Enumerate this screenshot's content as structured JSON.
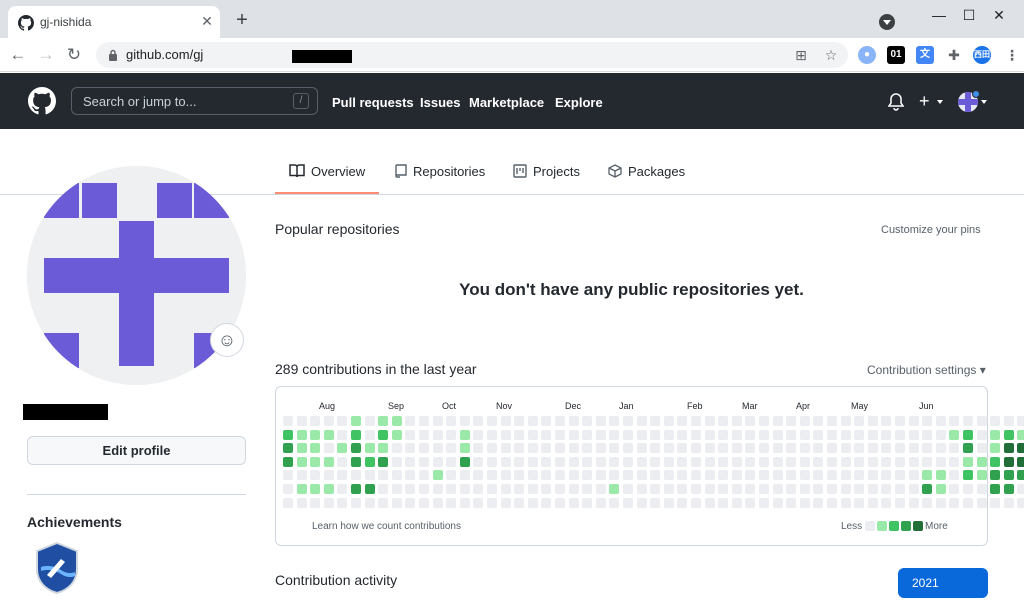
{
  "browser": {
    "tab_title": "gj-nishida",
    "tab_close": "✕",
    "new_tab": "+",
    "url": "github.com/gj",
    "window_controls": [
      "—",
      "☐",
      "✕"
    ],
    "extensions": [
      "01",
      "西田"
    ]
  },
  "header": {
    "search_placeholder": "Search or jump to...",
    "search_shortcut": "/",
    "nav": [
      "Pull requests",
      "Issues",
      "Marketplace",
      "Explore"
    ],
    "plus": "+"
  },
  "tabs": [
    {
      "label": "Overview",
      "icon": "book-icon",
      "active": true
    },
    {
      "label": "Repositories",
      "icon": "repo-icon",
      "active": false
    },
    {
      "label": "Projects",
      "icon": "project-icon",
      "active": false
    },
    {
      "label": "Packages",
      "icon": "package-icon",
      "active": false
    }
  ],
  "sidebar": {
    "emoji": "☺",
    "edit_profile": "Edit profile",
    "achievements_title": "Achievements"
  },
  "main": {
    "popular_title": "Popular repositories",
    "customize_pins": "Customize your pins",
    "no_repos": "You don't have any public repositories yet.",
    "contrib_title": "289 contributions in the last year",
    "contrib_settings": "Contribution settings ▾",
    "learn_link": "Learn how we count contributions",
    "legend_less": "Less",
    "legend_more": "More",
    "activity_title": "Contribution activity",
    "year_button": "2021"
  },
  "calendar": {
    "months": [
      "Aug",
      "Sep",
      "Oct",
      "Nov",
      "Dec",
      "Jan",
      "Feb",
      "Mar",
      "Apr",
      "May",
      "Jun"
    ],
    "colors": [
      "#ebedf0",
      "#9be9a8",
      "#40c463",
      "#30a14e",
      "#216e39"
    ],
    "weeks": [
      [
        0,
        2,
        3,
        3,
        0,
        0,
        0
      ],
      [
        0,
        1,
        1,
        1,
        0,
        1,
        0
      ],
      [
        0,
        1,
        1,
        1,
        0,
        1,
        0
      ],
      [
        0,
        1,
        0,
        1,
        0,
        1,
        0
      ],
      [
        0,
        0,
        1,
        0,
        0,
        0,
        0
      ],
      [
        1,
        2,
        3,
        3,
        0,
        3,
        0
      ],
      [
        0,
        0,
        1,
        2,
        0,
        3,
        0
      ],
      [
        1,
        2,
        1,
        3,
        0,
        0,
        0
      ],
      [
        1,
        1,
        0,
        0,
        0,
        0,
        0
      ],
      [
        0,
        0,
        0,
        0,
        0,
        0,
        0
      ],
      [
        0,
        0,
        0,
        0,
        0,
        0,
        0
      ],
      [
        0,
        0,
        0,
        0,
        1,
        0,
        0
      ],
      [
        0,
        0,
        0,
        0,
        0,
        0,
        0
      ],
      [
        0,
        1,
        1,
        3,
        0,
        0,
        0
      ],
      [
        0,
        0,
        0,
        0,
        0,
        0,
        0
      ],
      [
        0,
        0,
        0,
        0,
        0,
        0,
        0
      ],
      [
        0,
        0,
        0,
        0,
        0,
        0,
        0
      ],
      [
        0,
        0,
        0,
        0,
        0,
        0,
        0
      ],
      [
        0,
        0,
        0,
        0,
        0,
        0,
        0
      ],
      [
        0,
        0,
        0,
        0,
        0,
        0,
        0
      ],
      [
        0,
        0,
        0,
        0,
        0,
        0,
        0
      ],
      [
        0,
        0,
        0,
        0,
        0,
        0,
        0
      ],
      [
        0,
        0,
        0,
        0,
        0,
        0,
        0
      ],
      [
        0,
        0,
        0,
        0,
        0,
        0,
        0
      ],
      [
        0,
        0,
        0,
        0,
        0,
        1,
        0
      ],
      [
        0,
        0,
        0,
        0,
        0,
        0,
        0
      ],
      [
        0,
        0,
        0,
        0,
        0,
        0,
        0
      ],
      [
        0,
        0,
        0,
        0,
        0,
        0,
        0
      ],
      [
        0,
        0,
        0,
        0,
        0,
        0,
        0
      ],
      [
        0,
        0,
        0,
        0,
        0,
        0,
        0
      ],
      [
        0,
        0,
        0,
        0,
        0,
        0,
        0
      ],
      [
        0,
        0,
        0,
        0,
        0,
        0,
        0
      ],
      [
        0,
        0,
        0,
        0,
        0,
        0,
        0
      ],
      [
        0,
        0,
        0,
        0,
        0,
        0,
        0
      ],
      [
        0,
        0,
        0,
        0,
        0,
        0,
        0
      ],
      [
        0,
        0,
        0,
        0,
        0,
        0,
        0
      ],
      [
        0,
        0,
        0,
        0,
        0,
        0,
        0
      ],
      [
        0,
        0,
        0,
        0,
        0,
        0,
        0
      ],
      [
        0,
        0,
        0,
        0,
        0,
        0,
        0
      ],
      [
        0,
        0,
        0,
        0,
        0,
        0,
        0
      ],
      [
        0,
        0,
        0,
        0,
        0,
        0,
        0
      ],
      [
        0,
        0,
        0,
        0,
        0,
        0,
        0
      ],
      [
        0,
        0,
        0,
        0,
        0,
        0,
        0
      ],
      [
        0,
        0,
        0,
        0,
        0,
        0,
        0
      ],
      [
        0,
        0,
        0,
        0,
        0,
        0,
        0
      ],
      [
        0,
        0,
        0,
        0,
        0,
        0,
        0
      ],
      [
        0,
        0,
        0,
        0,
        0,
        0,
        0
      ],
      [
        0,
        0,
        0,
        0,
        1,
        3,
        0
      ],
      [
        0,
        0,
        0,
        0,
        1,
        1,
        0
      ],
      [
        0,
        1,
        0,
        0,
        0,
        0,
        0
      ],
      [
        0,
        2,
        3,
        1,
        2,
        0,
        0
      ],
      [
        0,
        0,
        0,
        1,
        1,
        0,
        0
      ],
      [
        0,
        1,
        1,
        2,
        3,
        3,
        0
      ],
      [
        0,
        2,
        4,
        4,
        3,
        3,
        0
      ],
      [
        0,
        1,
        4,
        4,
        3,
        0,
        0
      ]
    ]
  }
}
